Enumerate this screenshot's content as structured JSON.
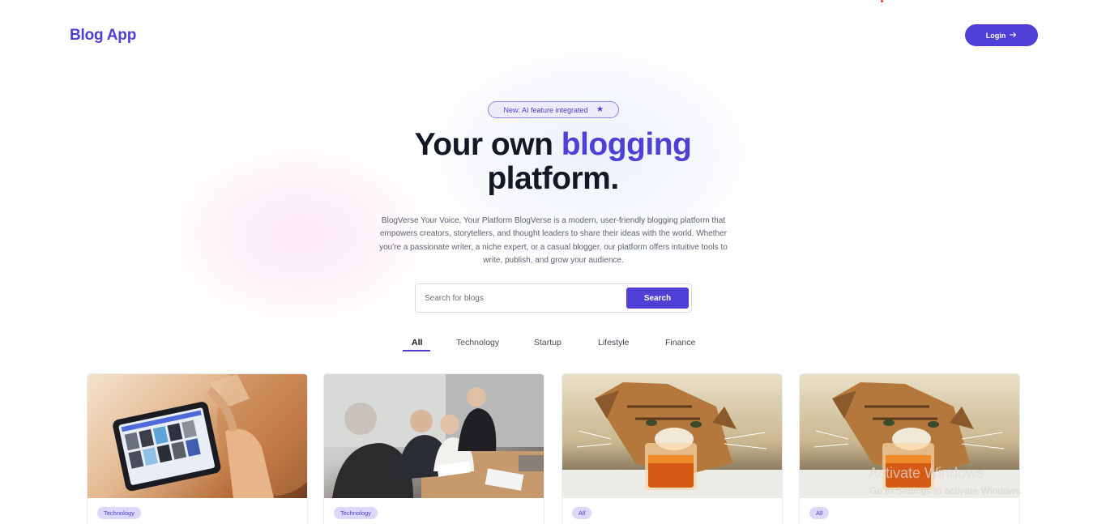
{
  "app": {
    "title": "Blog App"
  },
  "header": {
    "login_label": "Login",
    "login_icon": "arrow-right-icon"
  },
  "hero": {
    "badge_text": "New: AI feature integrated",
    "badge_icon": "sparkle-icon",
    "title_part1": "Your own ",
    "title_accent": "blogging",
    "title_part2": "platform.",
    "description": "BlogVerse Your Voice, Your Platform BlogVerse is a modern, user-friendly blogging platform that empowers creators, storytellers, and thought leaders to share their ideas with the world. Whether you're a passionate writer, a niche expert, or a casual blogger, our platform offers intuitive tools to write, publish, and grow your audience."
  },
  "search": {
    "placeholder": "Search for blogs",
    "value": "",
    "button_label": "Search"
  },
  "tabs": [
    {
      "label": "All",
      "active": true
    },
    {
      "label": "Technology",
      "active": false
    },
    {
      "label": "Startup",
      "active": false
    },
    {
      "label": "Lifestyle",
      "active": false
    },
    {
      "label": "Finance",
      "active": false
    }
  ],
  "cards": [
    {
      "tag": "Technology",
      "image": "tablet-photo"
    },
    {
      "tag": "Technology",
      "image": "meeting-photo"
    },
    {
      "tag": "All",
      "image": "cat-drink-photo"
    },
    {
      "tag": "All",
      "image": "cat-drink-photo"
    }
  ],
  "watermark": {
    "line1": "Activate Windows",
    "line2": "Go to Settings to activate Windows."
  },
  "colors": {
    "accent": "#4f3fd6",
    "tag_bg": "#dcd8fb",
    "text_dark": "#141826"
  }
}
